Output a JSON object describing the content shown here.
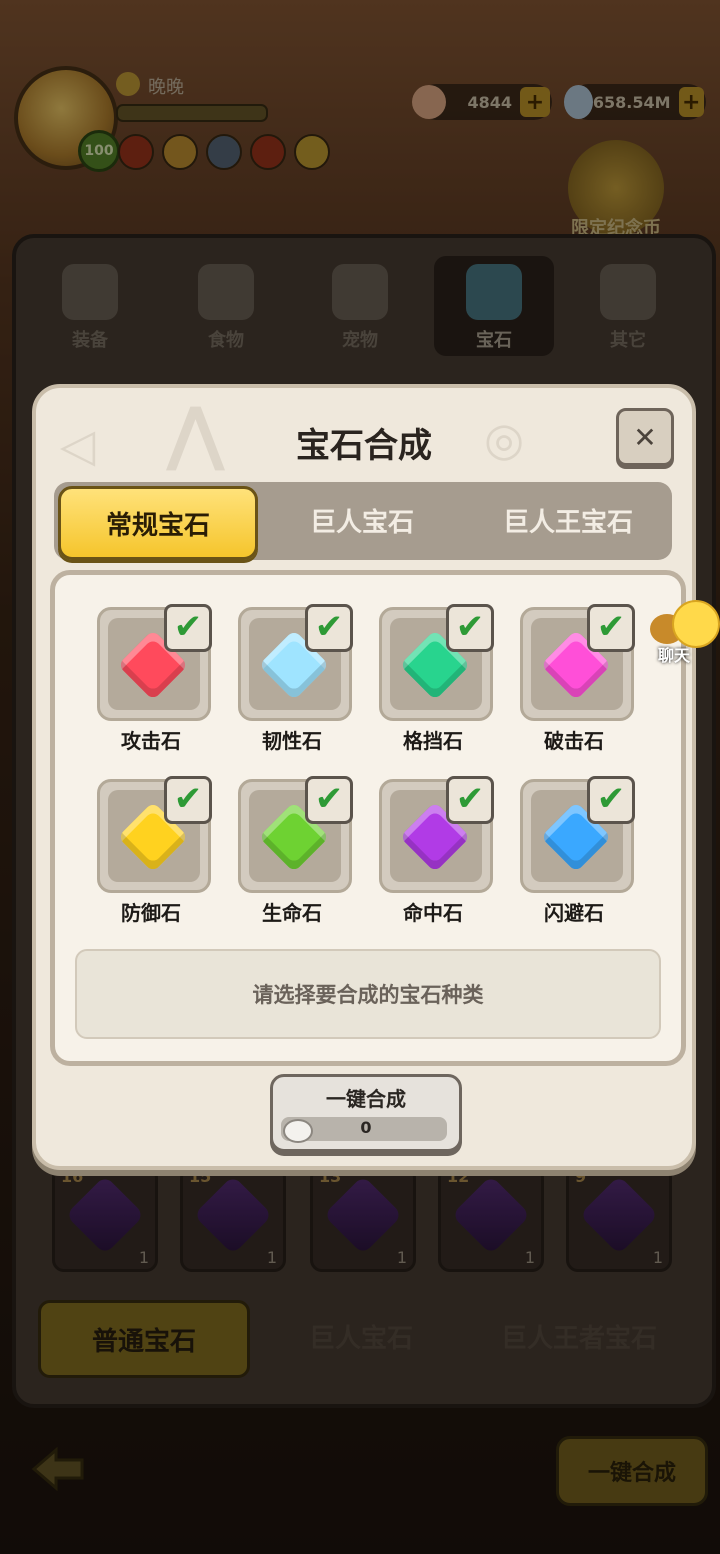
{
  "player": {
    "name": "晚晚",
    "level": "100"
  },
  "resources": [
    {
      "icon": "shell-icon",
      "value": "4844"
    },
    {
      "icon": "ore-icon",
      "value": "658.54M"
    }
  ],
  "limited_coin_label": "限定纪念币",
  "backdrop_tabs": [
    {
      "icon": "hammer-icon",
      "label": "装备"
    },
    {
      "icon": "food-icon",
      "label": "食物"
    },
    {
      "icon": "pet-icon",
      "label": "宠物"
    },
    {
      "icon": "gem-icon",
      "label": "宝石"
    },
    {
      "icon": "bone-icon",
      "label": "其它"
    }
  ],
  "backdrop_gem_cards": [
    {
      "level": "16",
      "count": "1"
    },
    {
      "level": "15",
      "count": "1"
    },
    {
      "level": "13",
      "count": "1"
    },
    {
      "level": "12",
      "count": "1"
    },
    {
      "level": "9",
      "count": "1"
    }
  ],
  "backdrop_bottom_tabs": [
    "普通宝石",
    "巨人宝石",
    "巨人王者宝石"
  ],
  "backdrop_onekey_label": "一键合成",
  "modal": {
    "title": "宝石合成",
    "segments": [
      "常规宝石",
      "巨人宝石",
      "巨人王宝石"
    ],
    "selected_segment": "常规宝石",
    "gems": [
      {
        "name": "攻击石",
        "color": "#ff4a5c",
        "checked": true
      },
      {
        "name": "韧性石",
        "color": "#9fe4ff",
        "checked": true
      },
      {
        "name": "格挡石",
        "color": "#28d48e",
        "checked": true
      },
      {
        "name": "破击石",
        "color": "#ff4fd8",
        "checked": true
      },
      {
        "name": "防御石",
        "color": "#ffd21f",
        "checked": true
      },
      {
        "name": "生命石",
        "color": "#6ed232",
        "checked": true
      },
      {
        "name": "命中石",
        "color": "#b13be6",
        "checked": true
      },
      {
        "name": "闪避石",
        "color": "#3aa8ff",
        "checked": true
      }
    ],
    "hint": "请选择要合成的宝石种类",
    "onekey_button": {
      "label": "一键合成",
      "cost": "0"
    }
  },
  "chat_label": "聊天",
  "colors": {
    "accent_yellow": "#f5c52c",
    "check_green": "#2e9a36",
    "modal_bg": "#efe8dc"
  }
}
